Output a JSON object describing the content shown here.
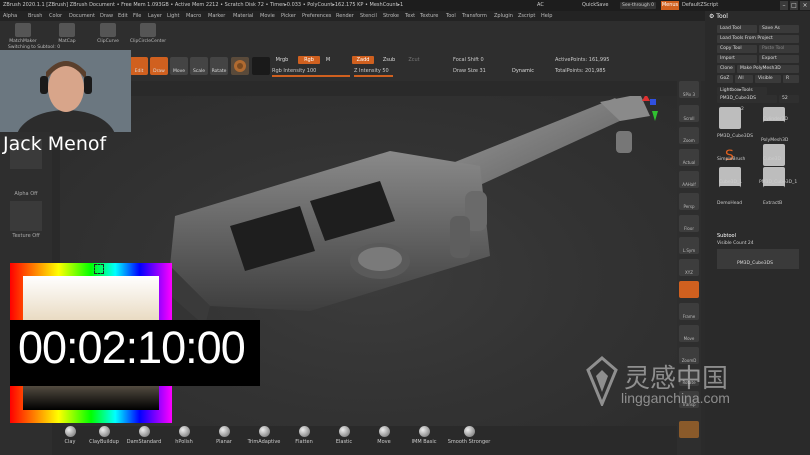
{
  "titlebar": {
    "title": "ZBrush 2020.1.1 [ZBrush]  ZBrush Document   • Free Mem 1.093GB • Active Mem 2212 • Scratch Disk 72 • Timer▸0.033 • PolyCount▸162.175 KP • MeshCount▸1",
    "ac": "AC",
    "quicksave": "QuickSave",
    "see_through": "See-through 0",
    "menus": "Menus",
    "default_script": "DefaultZScript"
  },
  "menubar": [
    "Alpha",
    "Brush",
    "Color",
    "Document",
    "Draw",
    "Edit",
    "File",
    "Layer",
    "Light",
    "Macro",
    "Marker",
    "Material",
    "Movie",
    "Picker",
    "Preferences",
    "Render",
    "Stencil",
    "Stroke",
    "Text",
    "Texture",
    "Tool",
    "Transform",
    "Zplugin",
    "Zscript",
    "Help"
  ],
  "shelf": {
    "items": [
      "MatchMaker",
      "MatCap",
      "ClipCurve",
      "ClipCircleCenter"
    ],
    "switch_label": "Switching to Subtool: 0",
    "subtool_name": "PM3D_Cube3DS",
    "tools": [
      "Edit",
      "Draw",
      "Move",
      "Scale",
      "Rotate"
    ],
    "mrgb": "Mrgb",
    "rgb": "Rgb",
    "m": "M",
    "zadd": "Zadd",
    "zsub": "Zsub",
    "zcut": "Zcut",
    "rgb_intensity": "Rgb Intensity 100",
    "z_intensity": "Z Intensity 50",
    "focal_shift": "Focal Shift 0",
    "draw_size": "Draw Size 31",
    "dynamic": "Dynamic",
    "active_points": "ActivePoints: 161,995",
    "total_points": "TotalPoints: 201,985",
    "rgb_intensity_value": 100,
    "z_intensity_value": 50
  },
  "leftpanel": {
    "alpha": "Alpha Off",
    "texture": "Texture Off"
  },
  "webcam": {
    "name": "Jack Menof"
  },
  "timer": "00:02:10:00",
  "rightstrip": [
    "SPix 3",
    "Scroll",
    "Zoom",
    "Actual",
    "AAHalf",
    "Persp",
    "Floor",
    "L.Sym",
    "XYZ",
    "Frame",
    "Move",
    "ZoomD",
    "Rotate",
    "Transp"
  ],
  "rightpanel": {
    "header": "Tool",
    "buttons": [
      [
        "Load Tool",
        "Save As"
      ],
      [
        "Load Tools From Project",
        ""
      ],
      [
        "Copy Tool",
        "Paste Tool"
      ],
      [
        "Import",
        "Export"
      ],
      [
        "Clone",
        "Make PolyMesh3D"
      ],
      [
        "GoZ",
        "All",
        "Visible",
        "R"
      ]
    ],
    "lightbox": "Lightbox▸Tools",
    "current_tool": "PM3D_Cube3DS",
    "current_count": "52",
    "thumbnails": [
      "PM3D_Cube3DS",
      "Cylinder3D",
      "PM3D_Cube3DS",
      "PolyMesh3D",
      "SimpleBrush",
      "Cube3D",
      "Cube3D_1",
      "PM3D_Cube3D_1",
      "DemoHead",
      "ExtractB"
    ],
    "thumb_counts": [
      "2",
      "3",
      "3",
      "4"
    ],
    "subtool_header": "Subtool",
    "visible_count": "Visible Count 24",
    "subtool_item": "PM3D_Cube3DS"
  },
  "brushes": [
    "Clay",
    "ClayBuildup",
    "DamStandard",
    "hPolish",
    "Planar",
    "TrimAdaptive",
    "Flatten",
    "Elastic",
    "Move",
    "IMM Basic",
    "Smooth Stronger"
  ],
  "watermark": {
    "cn": "灵感中国",
    "en": "lingganchina.com"
  }
}
